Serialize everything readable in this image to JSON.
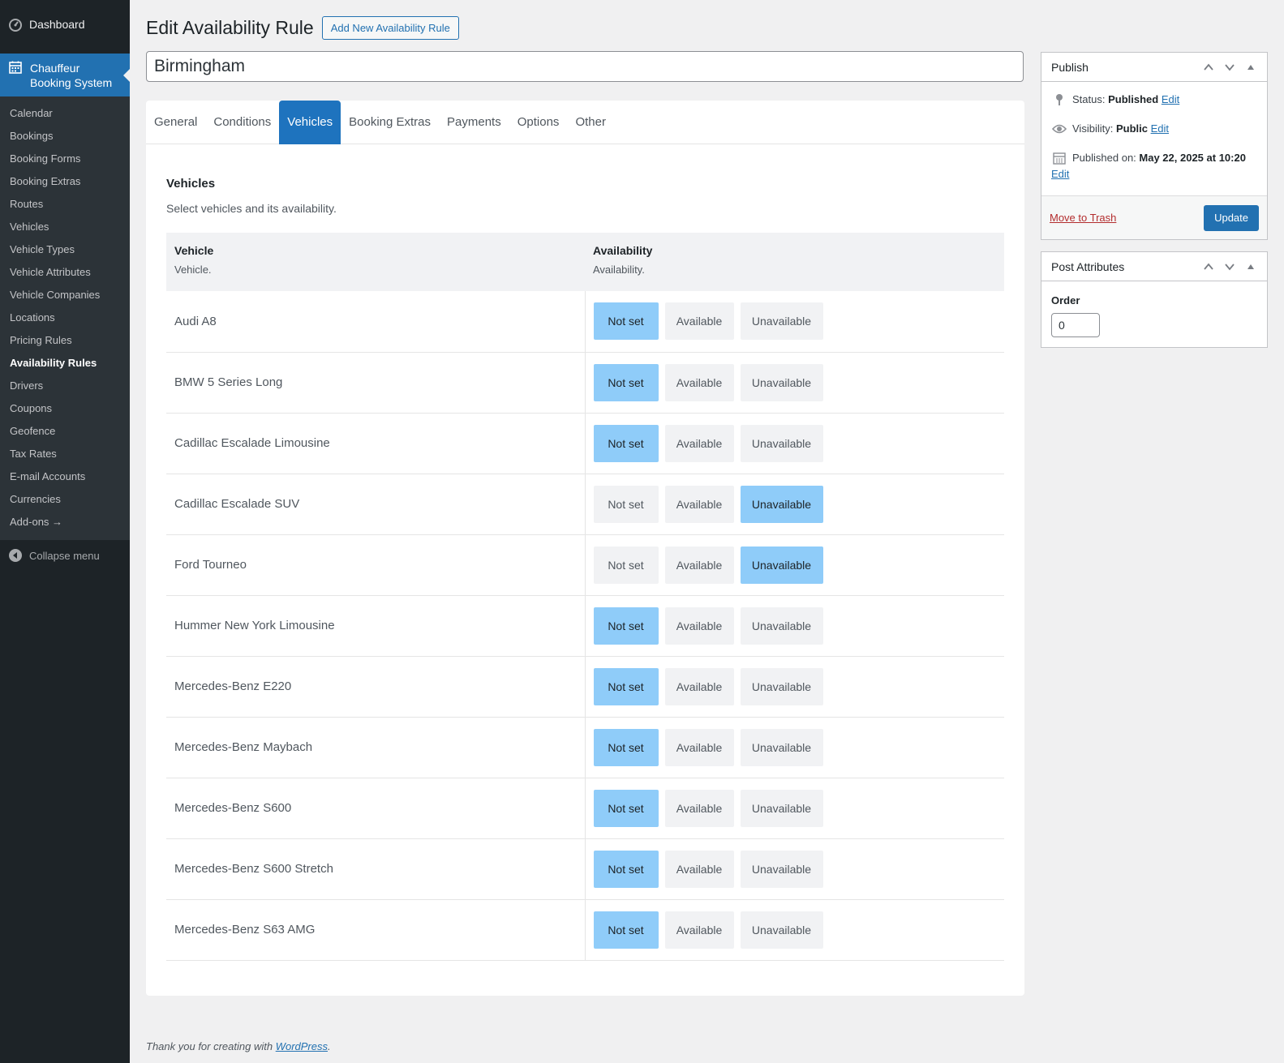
{
  "sidebar": {
    "dashboard": "Dashboard",
    "active_menu": "Chauffeur Booking System",
    "items": [
      {
        "label": "Calendar",
        "current": false
      },
      {
        "label": "Bookings",
        "current": false
      },
      {
        "label": "Booking Forms",
        "current": false
      },
      {
        "label": "Booking Extras",
        "current": false
      },
      {
        "label": "Routes",
        "current": false
      },
      {
        "label": "Vehicles",
        "current": false
      },
      {
        "label": "Vehicle Types",
        "current": false
      },
      {
        "label": "Vehicle Attributes",
        "current": false
      },
      {
        "label": "Vehicle Companies",
        "current": false
      },
      {
        "label": "Locations",
        "current": false
      },
      {
        "label": "Pricing Rules",
        "current": false
      },
      {
        "label": "Availability Rules",
        "current": true
      },
      {
        "label": "Drivers",
        "current": false
      },
      {
        "label": "Coupons",
        "current": false
      },
      {
        "label": "Geofence",
        "current": false
      },
      {
        "label": "Tax Rates",
        "current": false
      },
      {
        "label": "E-mail Accounts",
        "current": false
      },
      {
        "label": "Currencies",
        "current": false
      },
      {
        "label": "Add-ons →",
        "current": false
      }
    ],
    "collapse": "Collapse menu"
  },
  "header": {
    "title": "Edit Availability Rule",
    "add_new": "Add New Availability Rule",
    "post_title": "Birmingham"
  },
  "tabs": [
    {
      "label": "General",
      "active": false
    },
    {
      "label": "Conditions",
      "active": false
    },
    {
      "label": "Vehicles",
      "active": true
    },
    {
      "label": "Booking Extras",
      "active": false
    },
    {
      "label": "Payments",
      "active": false
    },
    {
      "label": "Options",
      "active": false
    },
    {
      "label": "Other",
      "active": false
    }
  ],
  "vehicles_section": {
    "title": "Vehicles",
    "description": "Select vehicles and its availability.",
    "col_vehicle": "Vehicle",
    "col_vehicle_sub": "Vehicle.",
    "col_availability": "Availability",
    "col_availability_sub": "Availability.",
    "options": [
      "Not set",
      "Available",
      "Unavailable"
    ],
    "rows": [
      {
        "name": "Audi A8",
        "selected": "Not set"
      },
      {
        "name": "BMW 5 Series Long",
        "selected": "Not set"
      },
      {
        "name": "Cadillac Escalade Limousine",
        "selected": "Not set"
      },
      {
        "name": "Cadillac Escalade SUV",
        "selected": "Unavailable"
      },
      {
        "name": "Ford Tourneo",
        "selected": "Unavailable"
      },
      {
        "name": "Hummer New York Limousine",
        "selected": "Not set"
      },
      {
        "name": "Mercedes-Benz E220",
        "selected": "Not set"
      },
      {
        "name": "Mercedes-Benz Maybach",
        "selected": "Not set"
      },
      {
        "name": "Mercedes-Benz S600",
        "selected": "Not set"
      },
      {
        "name": "Mercedes-Benz S600 Stretch",
        "selected": "Not set"
      },
      {
        "name": "Mercedes-Benz S63 AMG",
        "selected": "Not set"
      }
    ]
  },
  "publish": {
    "title": "Publish",
    "status_label": "Status:",
    "status_value": "Published",
    "visibility_label": "Visibility:",
    "visibility_value": "Public",
    "published_label": "Published on:",
    "published_value": "May 22, 2025 at 10:20",
    "edit": "Edit",
    "trash": "Move to Trash",
    "update": "Update"
  },
  "attributes": {
    "title": "Post Attributes",
    "order_label": "Order",
    "order_value": "0"
  },
  "footer": {
    "text": "Thank you for creating with ",
    "link": "WordPress",
    "end": "."
  },
  "colors": {
    "sidebar_bg": "#1d2327",
    "accent": "#2271b1",
    "tab_active": "#1e73be",
    "option_selected": "#8fccf9",
    "trash": "#b32d2e"
  }
}
